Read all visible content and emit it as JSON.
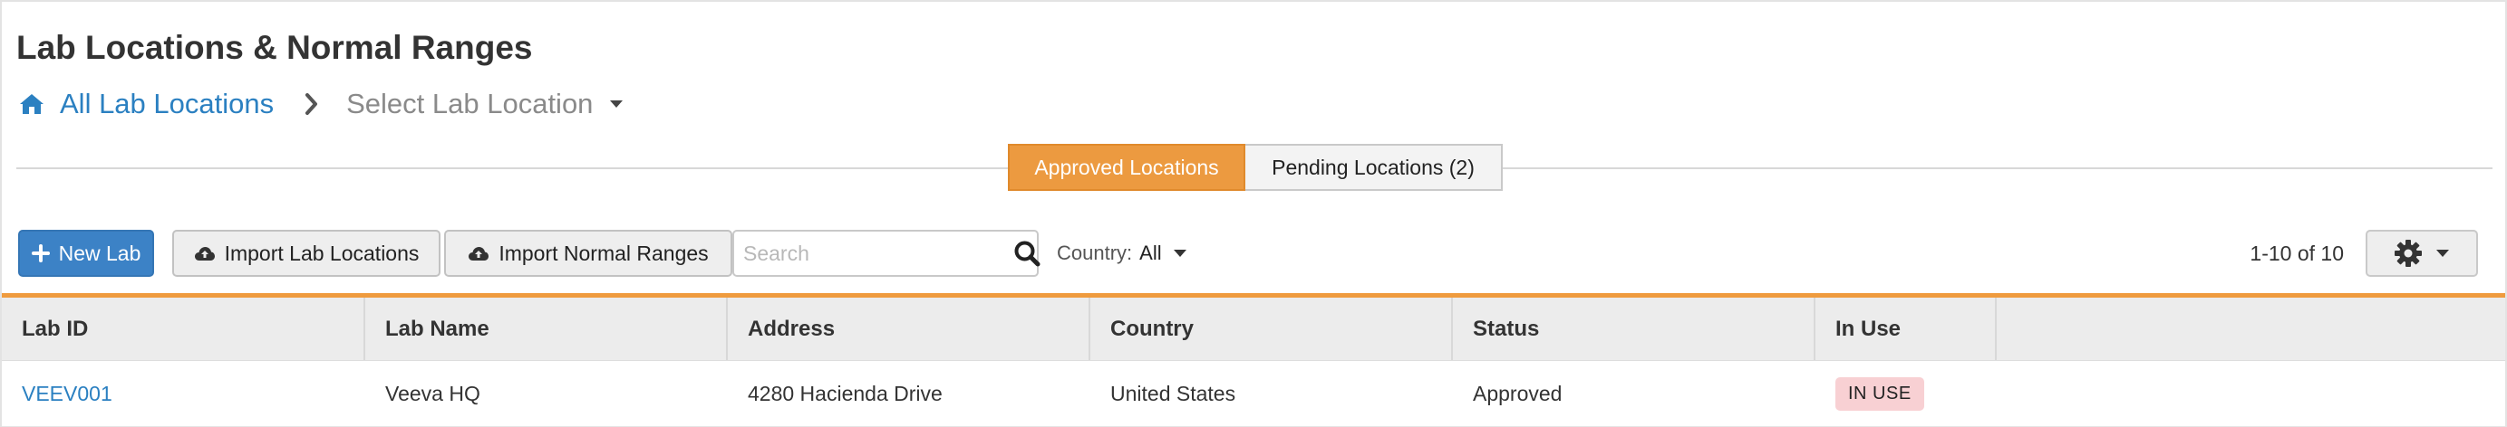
{
  "page": {
    "title": "Lab Locations & Normal Ranges"
  },
  "breadcrumb": {
    "home_label": "All Lab Locations",
    "home_icon": "home-icon",
    "separator_icon": "chevron-right-icon",
    "current_label": "Select Lab Location",
    "current_icon": "caret-down-icon"
  },
  "tabs": [
    {
      "label": "Approved Locations",
      "active": true
    },
    {
      "label": "Pending Locations (2)",
      "active": false
    }
  ],
  "toolbar": {
    "new_lab_label": "New Lab",
    "import_locations_label": "Import Lab Locations",
    "import_ranges_label": "Import Normal Ranges",
    "search_placeholder": "Search",
    "search_value": "",
    "country_label": "Country:",
    "country_value": "All",
    "pagination": "1-10 of 10"
  },
  "table": {
    "columns": [
      "Lab ID",
      "Lab Name",
      "Address",
      "Country",
      "Status",
      "In Use"
    ],
    "rows": [
      {
        "lab_id": "VEEV001",
        "lab_name": "Veeva HQ",
        "address": "4280 Hacienda Drive",
        "country": "United States",
        "status": "Approved",
        "in_use": "IN USE"
      }
    ]
  },
  "colors": {
    "accent_orange": "#ec9a40",
    "link_blue": "#2b80c1",
    "primary_button": "#3c82c6",
    "in_use_badge": "#f8d0d3"
  }
}
